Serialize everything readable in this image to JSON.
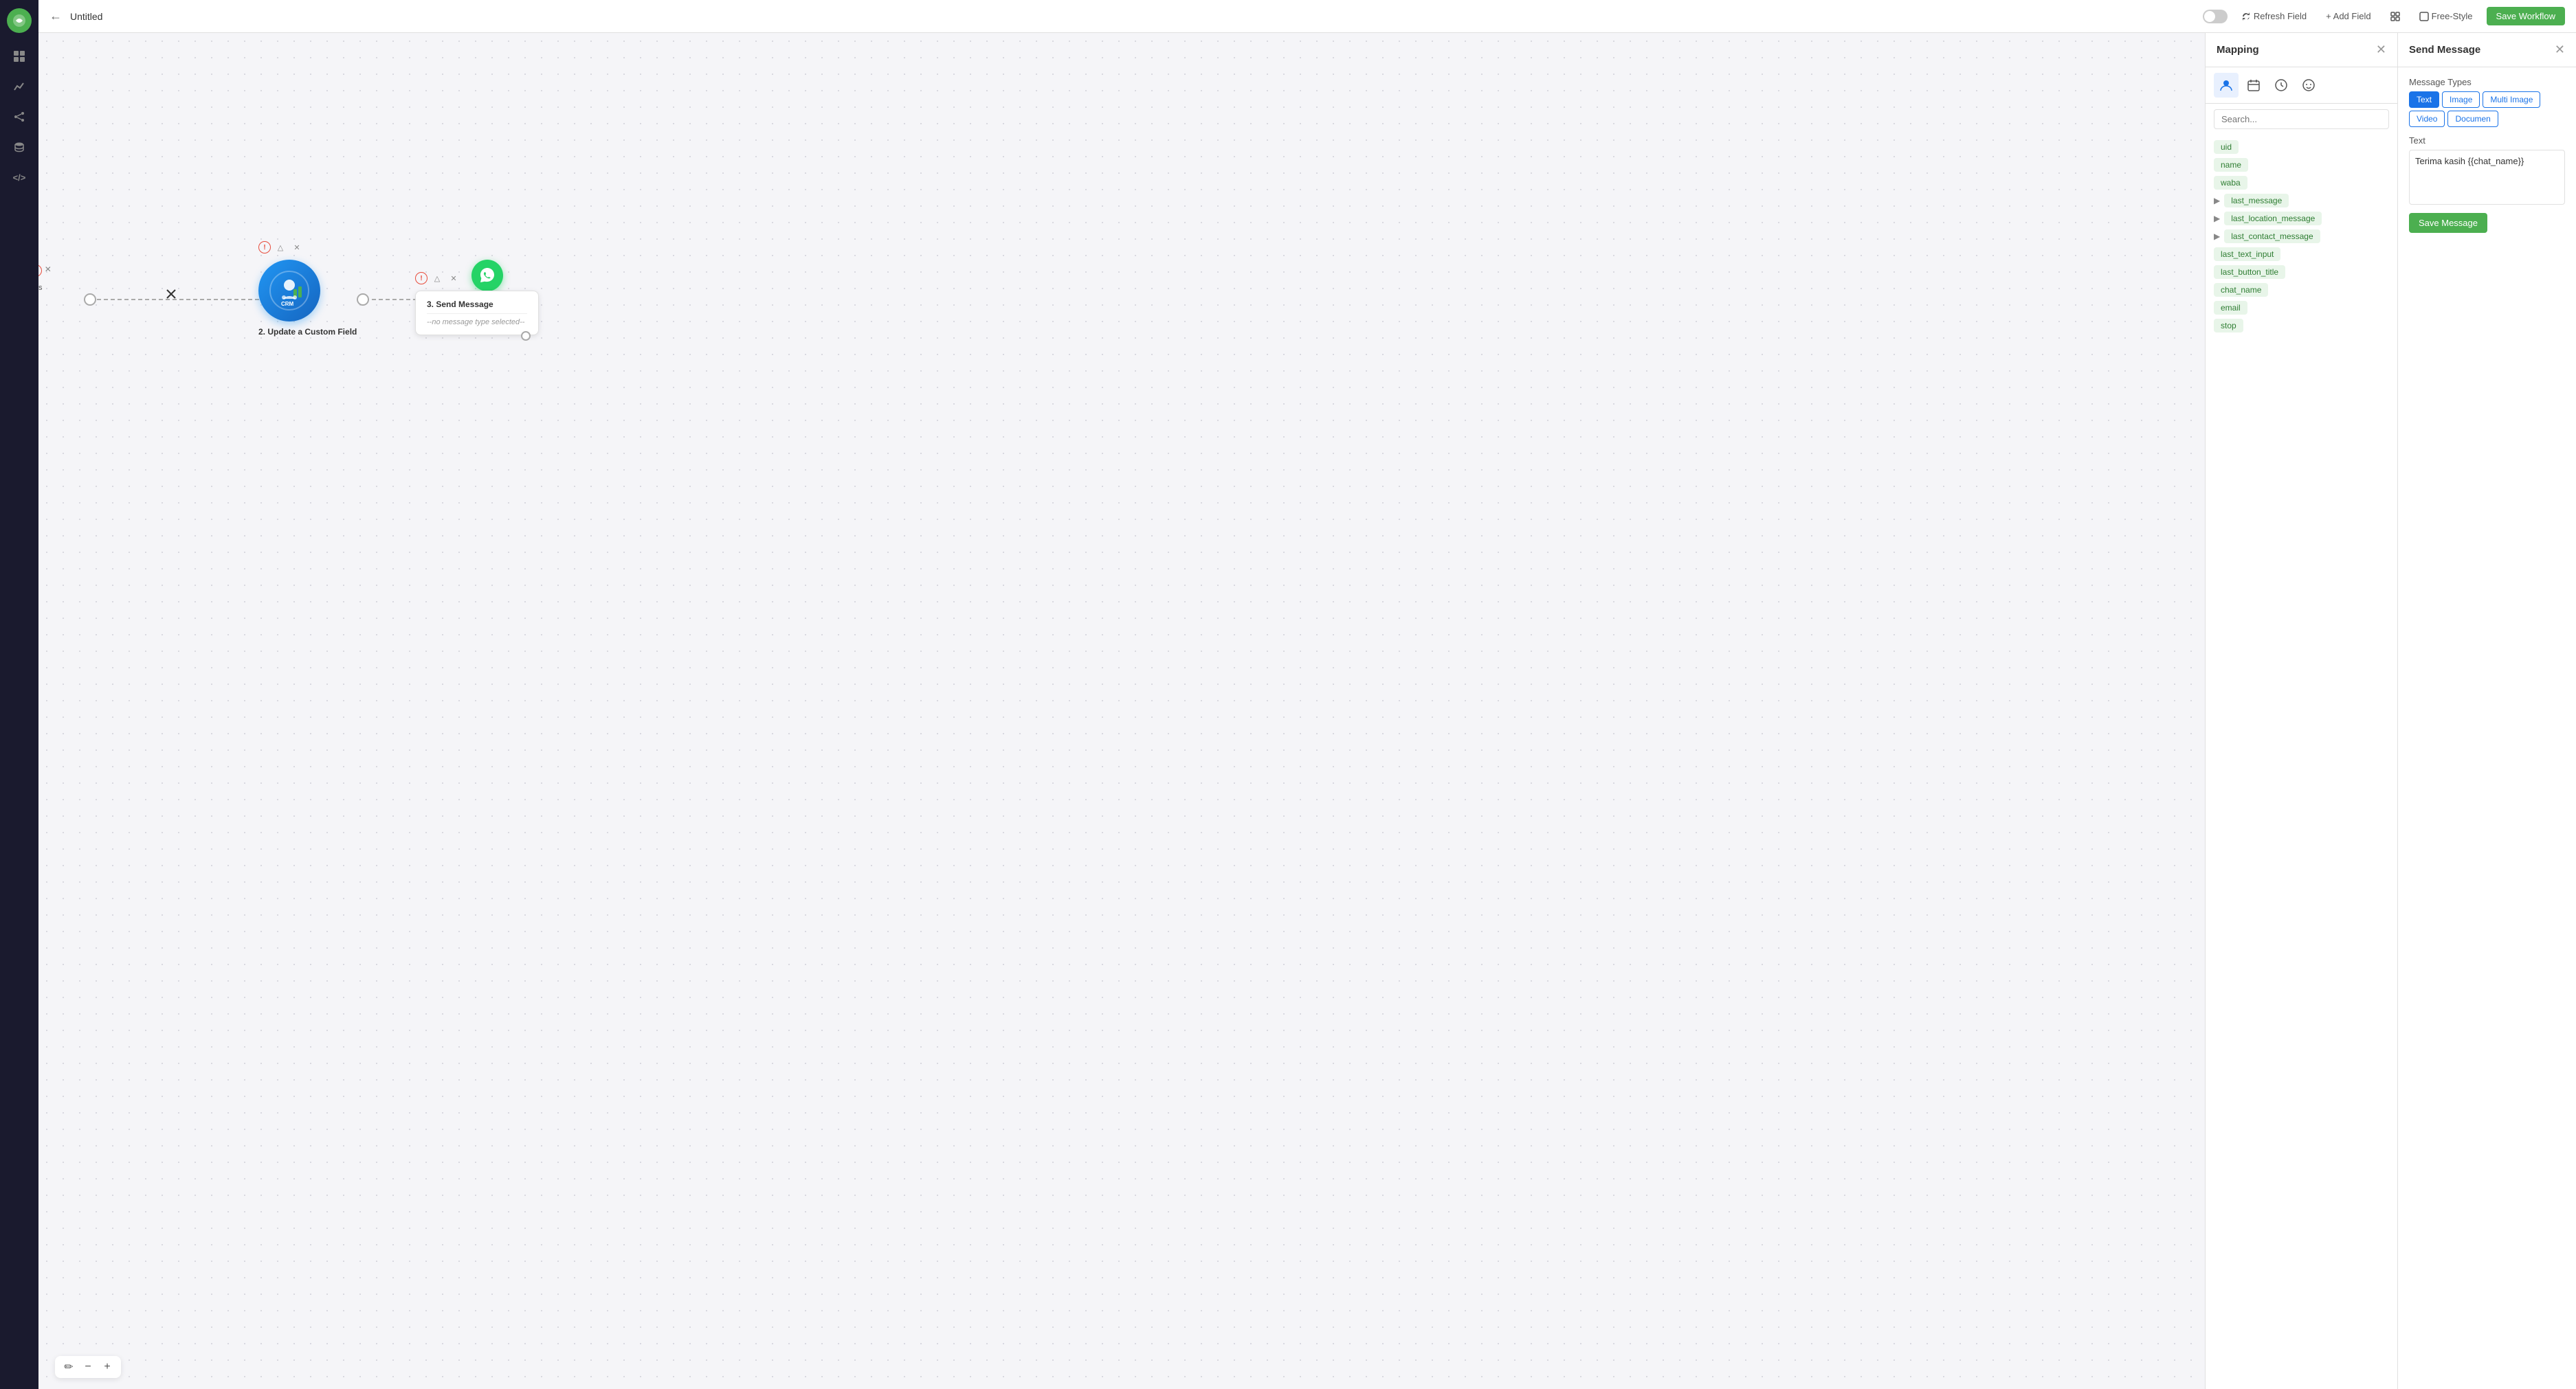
{
  "sidebar": {
    "logo_icon": "🟢",
    "items": [
      {
        "name": "home-icon",
        "icon": "⊞",
        "label": "Home"
      },
      {
        "name": "chart-icon",
        "icon": "📈",
        "label": "Analytics"
      },
      {
        "name": "share-icon",
        "icon": "⇄",
        "label": "Share"
      },
      {
        "name": "database-icon",
        "icon": "🗄",
        "label": "Database"
      },
      {
        "name": "code-icon",
        "icon": "</>",
        "label": "Code"
      }
    ]
  },
  "topbar": {
    "title": "Untitled",
    "refresh_label": "Refresh Field",
    "add_field_label": "+ Add Field",
    "free_style_label": "Free-Style",
    "save_label": "Save Workflow",
    "toggle_state": false
  },
  "mapping": {
    "title": "Mapping",
    "search_placeholder": "Search...",
    "tabs": [
      {
        "name": "contact-tab",
        "icon": "👤",
        "active": true
      },
      {
        "name": "calendar-tab",
        "icon": "📅",
        "active": false
      },
      {
        "name": "clock-tab",
        "icon": "🕐",
        "active": false
      },
      {
        "name": "emoji-tab",
        "icon": "😊",
        "active": false
      }
    ],
    "fields": [
      {
        "label": "uid",
        "has_arrow": false
      },
      {
        "label": "name",
        "has_arrow": false
      },
      {
        "label": "waba",
        "has_arrow": false
      },
      {
        "label": "last_message",
        "has_arrow": true
      },
      {
        "label": "last_location_message",
        "has_arrow": true
      },
      {
        "label": "last_contact_message",
        "has_arrow": true
      },
      {
        "label": "last_text_input",
        "has_arrow": false
      },
      {
        "label": "last_button_title",
        "has_arrow": false
      },
      {
        "label": "chat_name",
        "has_arrow": false
      },
      {
        "label": "email",
        "has_arrow": false
      },
      {
        "label": "stop",
        "has_arrow": false
      }
    ]
  },
  "send_message": {
    "title": "Send Message",
    "message_types_label": "Message Types",
    "types": [
      {
        "label": "Text",
        "active": true
      },
      {
        "label": "Image",
        "active": false
      },
      {
        "label": "Multi Image",
        "active": false
      },
      {
        "label": "Video",
        "active": false
      },
      {
        "label": "Document",
        "active": false
      }
    ],
    "text_label": "Text",
    "text_value": "Terima kasih {{chat_name}}",
    "save_button_label": "Save Message"
  },
  "workflow": {
    "nodes": [
      {
        "id": "node-2",
        "label": "2. Update a Custom Field",
        "type": "crm"
      },
      {
        "id": "node-3",
        "label": "3. Send Message",
        "subtitle": "--no message type selected--",
        "type": "whatsapp"
      }
    ]
  },
  "zoom": {
    "pencil_icon": "✏",
    "minus_icon": "−",
    "plus_icon": "+"
  },
  "help": {
    "icon": "?"
  }
}
